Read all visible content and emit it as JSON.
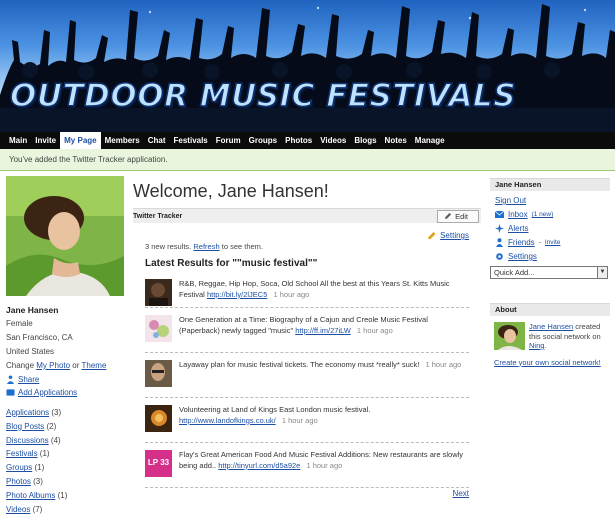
{
  "site": {
    "title": "OUTDOOR MUSIC FESTIVALS"
  },
  "nav": [
    {
      "label": "Main"
    },
    {
      "label": "Invite"
    },
    {
      "label": "My Page",
      "active": true
    },
    {
      "label": "Members"
    },
    {
      "label": "Chat"
    },
    {
      "label": "Festivals"
    },
    {
      "label": "Forum"
    },
    {
      "label": "Groups"
    },
    {
      "label": "Photos"
    },
    {
      "label": "Videos"
    },
    {
      "label": "Blogs"
    },
    {
      "label": "Notes"
    },
    {
      "label": "Manage"
    }
  ],
  "notice": "You've added the Twitter Tracker application.",
  "profile": {
    "name": "Jane Hansen",
    "gender": "Female",
    "city": "San Francisco, CA",
    "country": "United States",
    "change_prefix": "Change",
    "my_photo": "My Photo",
    "or": "or",
    "theme": "Theme",
    "share": "Share",
    "add_apps": "Add Applications"
  },
  "counts": [
    {
      "label": "Applications",
      "count": "(3)"
    },
    {
      "label": "Blog Posts",
      "count": "(2)"
    },
    {
      "label": "Discussions",
      "count": "(4)"
    },
    {
      "label": "Festivals",
      "count": "(1)"
    },
    {
      "label": "Groups",
      "count": "(1)"
    },
    {
      "label": "Photos",
      "count": "(3)"
    },
    {
      "label": "Photo Albums",
      "count": "(1)"
    },
    {
      "label": "Videos",
      "count": "(7)"
    }
  ],
  "main": {
    "welcome": "Welcome, Jane Hansen!",
    "box_title": "Twitter Tracker",
    "edit": "Edit",
    "settings": "Settings",
    "results_prefix": "3 new results.",
    "refresh": "Refresh",
    "results_suffix": "to see them.",
    "latest": "Latest Results for \"\"music festival\"\"",
    "next": "Next",
    "feed": [
      {
        "text": "R&B, Reggae, Hip Hop, Soca, Old School All the best at this Years St. Kitts Music Festival",
        "link": "http://bit.ly/2lJEC5",
        "ago": "1 hour ago",
        "thumb": "#3a2a1e"
      },
      {
        "text": "One Generation at a Time: Biography of a Cajun and Creole Music Festival (Paperback) newly tagged \"music\"",
        "link": "http://ff.im/27iLW",
        "ago": "1 hour ago",
        "thumb": "#e7c3d6"
      },
      {
        "text": "Layaway plan for music festival tickets. The economy must *really* suck!",
        "link": "",
        "ago": "1 hour ago",
        "thumb": "#6b5a45"
      },
      {
        "text": "Volunteering at Land of Kings East London music festival.",
        "link": "http://www.landofkings.co.uk/",
        "ago": "1 hour ago",
        "thumb": "#b86a1e"
      },
      {
        "text": "Flay's Great American Food And Music Festival Additions: New restaurants are slowly being add..",
        "link": "http://tinyurl.com/d5a92e",
        "ago": "1 hour ago",
        "thumb": "#d62f8a",
        "thumb_text": "LP 33"
      }
    ]
  },
  "sidebar": {
    "name": "Jane Hansen",
    "sign_out": "Sign Out",
    "inbox": "Inbox",
    "inbox_new": "(1 new)",
    "alerts": "Alerts",
    "friends": "Friends",
    "invite": "Invite",
    "settings": "Settings",
    "quick_add": "Quick Add...",
    "about_title": "About",
    "about_name": "Jane Hansen",
    "about_text": "created this social network on",
    "about_ning": "Ning",
    "create": "Create your own social network!"
  },
  "colors": {
    "link": "#1d4fa3",
    "nav_bg": "#0b0b0b",
    "notice_bg": "#e9f5dc"
  }
}
